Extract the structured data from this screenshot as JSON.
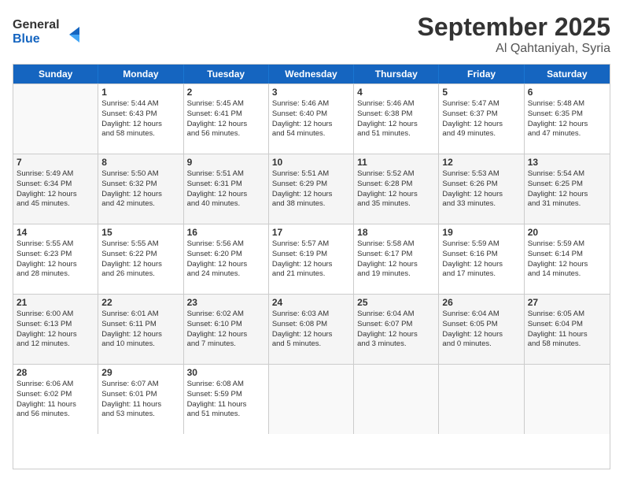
{
  "logo": {
    "line1": "General",
    "line2": "Blue"
  },
  "title": "September 2025",
  "subtitle": "Al Qahtaniyah, Syria",
  "days_of_week": [
    "Sunday",
    "Monday",
    "Tuesday",
    "Wednesday",
    "Thursday",
    "Friday",
    "Saturday"
  ],
  "weeks": [
    [
      {
        "day": "",
        "info": ""
      },
      {
        "day": "1",
        "info": "Sunrise: 5:44 AM\nSunset: 6:43 PM\nDaylight: 12 hours\nand 58 minutes."
      },
      {
        "day": "2",
        "info": "Sunrise: 5:45 AM\nSunset: 6:41 PM\nDaylight: 12 hours\nand 56 minutes."
      },
      {
        "day": "3",
        "info": "Sunrise: 5:46 AM\nSunset: 6:40 PM\nDaylight: 12 hours\nand 54 minutes."
      },
      {
        "day": "4",
        "info": "Sunrise: 5:46 AM\nSunset: 6:38 PM\nDaylight: 12 hours\nand 51 minutes."
      },
      {
        "day": "5",
        "info": "Sunrise: 5:47 AM\nSunset: 6:37 PM\nDaylight: 12 hours\nand 49 minutes."
      },
      {
        "day": "6",
        "info": "Sunrise: 5:48 AM\nSunset: 6:35 PM\nDaylight: 12 hours\nand 47 minutes."
      }
    ],
    [
      {
        "day": "7",
        "info": "Sunrise: 5:49 AM\nSunset: 6:34 PM\nDaylight: 12 hours\nand 45 minutes."
      },
      {
        "day": "8",
        "info": "Sunrise: 5:50 AM\nSunset: 6:32 PM\nDaylight: 12 hours\nand 42 minutes."
      },
      {
        "day": "9",
        "info": "Sunrise: 5:51 AM\nSunset: 6:31 PM\nDaylight: 12 hours\nand 40 minutes."
      },
      {
        "day": "10",
        "info": "Sunrise: 5:51 AM\nSunset: 6:29 PM\nDaylight: 12 hours\nand 38 minutes."
      },
      {
        "day": "11",
        "info": "Sunrise: 5:52 AM\nSunset: 6:28 PM\nDaylight: 12 hours\nand 35 minutes."
      },
      {
        "day": "12",
        "info": "Sunrise: 5:53 AM\nSunset: 6:26 PM\nDaylight: 12 hours\nand 33 minutes."
      },
      {
        "day": "13",
        "info": "Sunrise: 5:54 AM\nSunset: 6:25 PM\nDaylight: 12 hours\nand 31 minutes."
      }
    ],
    [
      {
        "day": "14",
        "info": "Sunrise: 5:55 AM\nSunset: 6:23 PM\nDaylight: 12 hours\nand 28 minutes."
      },
      {
        "day": "15",
        "info": "Sunrise: 5:55 AM\nSunset: 6:22 PM\nDaylight: 12 hours\nand 26 minutes."
      },
      {
        "day": "16",
        "info": "Sunrise: 5:56 AM\nSunset: 6:20 PM\nDaylight: 12 hours\nand 24 minutes."
      },
      {
        "day": "17",
        "info": "Sunrise: 5:57 AM\nSunset: 6:19 PM\nDaylight: 12 hours\nand 21 minutes."
      },
      {
        "day": "18",
        "info": "Sunrise: 5:58 AM\nSunset: 6:17 PM\nDaylight: 12 hours\nand 19 minutes."
      },
      {
        "day": "19",
        "info": "Sunrise: 5:59 AM\nSunset: 6:16 PM\nDaylight: 12 hours\nand 17 minutes."
      },
      {
        "day": "20",
        "info": "Sunrise: 5:59 AM\nSunset: 6:14 PM\nDaylight: 12 hours\nand 14 minutes."
      }
    ],
    [
      {
        "day": "21",
        "info": "Sunrise: 6:00 AM\nSunset: 6:13 PM\nDaylight: 12 hours\nand 12 minutes."
      },
      {
        "day": "22",
        "info": "Sunrise: 6:01 AM\nSunset: 6:11 PM\nDaylight: 12 hours\nand 10 minutes."
      },
      {
        "day": "23",
        "info": "Sunrise: 6:02 AM\nSunset: 6:10 PM\nDaylight: 12 hours\nand 7 minutes."
      },
      {
        "day": "24",
        "info": "Sunrise: 6:03 AM\nSunset: 6:08 PM\nDaylight: 12 hours\nand 5 minutes."
      },
      {
        "day": "25",
        "info": "Sunrise: 6:04 AM\nSunset: 6:07 PM\nDaylight: 12 hours\nand 3 minutes."
      },
      {
        "day": "26",
        "info": "Sunrise: 6:04 AM\nSunset: 6:05 PM\nDaylight: 12 hours\nand 0 minutes."
      },
      {
        "day": "27",
        "info": "Sunrise: 6:05 AM\nSunset: 6:04 PM\nDaylight: 11 hours\nand 58 minutes."
      }
    ],
    [
      {
        "day": "28",
        "info": "Sunrise: 6:06 AM\nSunset: 6:02 PM\nDaylight: 11 hours\nand 56 minutes."
      },
      {
        "day": "29",
        "info": "Sunrise: 6:07 AM\nSunset: 6:01 PM\nDaylight: 11 hours\nand 53 minutes."
      },
      {
        "day": "30",
        "info": "Sunrise: 6:08 AM\nSunset: 5:59 PM\nDaylight: 11 hours\nand 51 minutes."
      },
      {
        "day": "",
        "info": ""
      },
      {
        "day": "",
        "info": ""
      },
      {
        "day": "",
        "info": ""
      },
      {
        "day": "",
        "info": ""
      }
    ]
  ]
}
